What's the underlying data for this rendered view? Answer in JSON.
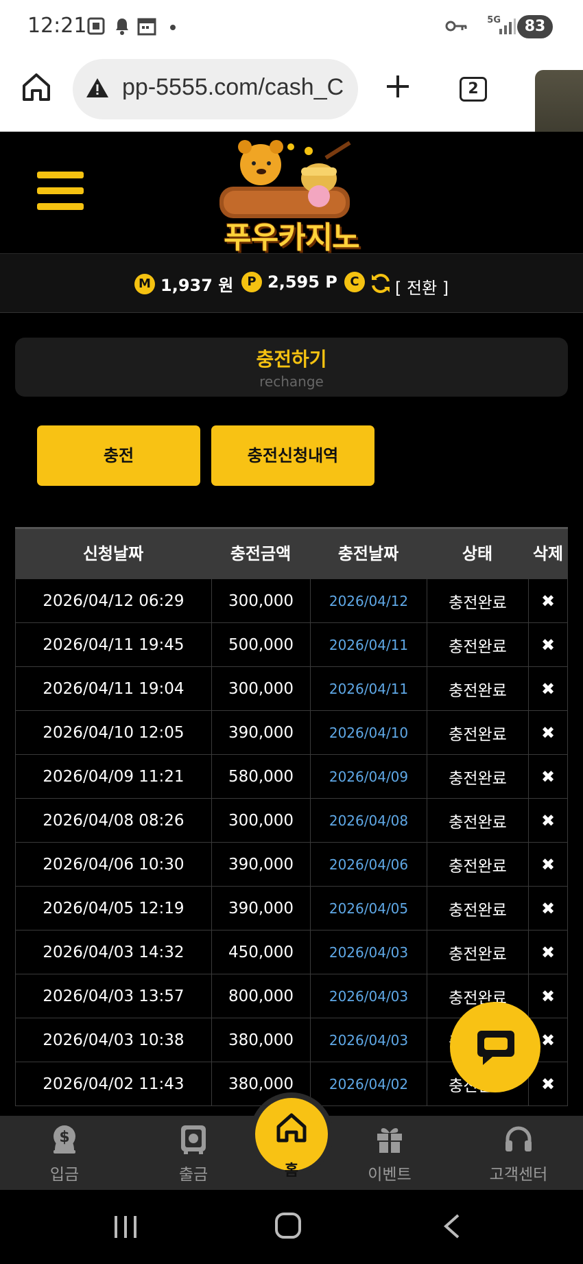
{
  "status_bar": {
    "time": "12:21",
    "network": "5G",
    "battery": "83"
  },
  "browser": {
    "url": "pp-5555.com/cash_C",
    "tab_count": "2"
  },
  "site": {
    "logo_text": "푸우카지노"
  },
  "balance": {
    "money_icon": "M",
    "money": "1,937 원",
    "point_icon": "P",
    "points": "2,595 P",
    "comp_icon": "C",
    "convert_label": "[ 전환 ]"
  },
  "section": {
    "title": "충전하기",
    "subtitle": "rechange"
  },
  "tabs": [
    {
      "label": "충전"
    },
    {
      "label": "충전신청내역"
    }
  ],
  "table": {
    "headers": [
      "신청날짜",
      "충전금액",
      "충전날짜",
      "상태",
      "삭제"
    ],
    "rows": [
      {
        "requested": "2026/04/12 06:29",
        "amount": "300,000",
        "charged": "2026/04/12",
        "status": "충전완료",
        "delete": "✖"
      },
      {
        "requested": "2026/04/11 19:45",
        "amount": "500,000",
        "charged": "2026/04/11",
        "status": "충전완료",
        "delete": "✖"
      },
      {
        "requested": "2026/04/11 19:04",
        "amount": "300,000",
        "charged": "2026/04/11",
        "status": "충전완료",
        "delete": "✖"
      },
      {
        "requested": "2026/04/10 12:05",
        "amount": "390,000",
        "charged": "2026/04/10",
        "status": "충전완료",
        "delete": "✖"
      },
      {
        "requested": "2026/04/09 11:21",
        "amount": "580,000",
        "charged": "2026/04/09",
        "status": "충전완료",
        "delete": "✖"
      },
      {
        "requested": "2026/04/08 08:26",
        "amount": "300,000",
        "charged": "2026/04/08",
        "status": "충전완료",
        "delete": "✖"
      },
      {
        "requested": "2026/04/06 10:30",
        "amount": "390,000",
        "charged": "2026/04/06",
        "status": "충전완료",
        "delete": "✖"
      },
      {
        "requested": "2026/04/05 12:19",
        "amount": "390,000",
        "charged": "2026/04/05",
        "status": "충전완료",
        "delete": "✖"
      },
      {
        "requested": "2026/04/03 14:32",
        "amount": "450,000",
        "charged": "2026/04/03",
        "status": "충전완료",
        "delete": "✖"
      },
      {
        "requested": "2026/04/03 13:57",
        "amount": "800,000",
        "charged": "2026/04/03",
        "status": "충전완료",
        "delete": "✖"
      },
      {
        "requested": "2026/04/03 10:38",
        "amount": "380,000",
        "charged": "2026/04/03",
        "status": "충전완료",
        "delete": "✖"
      },
      {
        "requested": "2026/04/02 11:43",
        "amount": "380,000",
        "charged": "2026/04/02",
        "status": "충전완료",
        "delete": "✖"
      }
    ]
  },
  "bottom_nav": [
    {
      "label": "입금",
      "icon": "dollar-bag-icon"
    },
    {
      "label": "출금",
      "icon": "safe-icon"
    },
    {
      "label": "홈",
      "icon": "home-icon"
    },
    {
      "label": "이벤트",
      "icon": "gift-icon"
    },
    {
      "label": "고객센터",
      "icon": "headset-icon"
    }
  ],
  "colors": {
    "accent": "#f8c214",
    "link_date": "#5fa8e6",
    "bg": "#000000"
  }
}
